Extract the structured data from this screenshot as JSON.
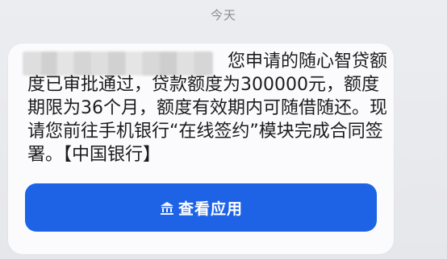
{
  "header": {
    "date_label": "今天"
  },
  "message": {
    "sender_redacted": true,
    "text": "您申请的随心智贷额度已审批通过，贷款额度为300000元，额度期限为36个月，额度有效期内可随借随还。现请您前往手机银行“在线签约”模块完成合同签署。【中国银行】"
  },
  "action": {
    "icon": "bank-icon",
    "label": "查看应用",
    "background": "#1e63e6"
  }
}
